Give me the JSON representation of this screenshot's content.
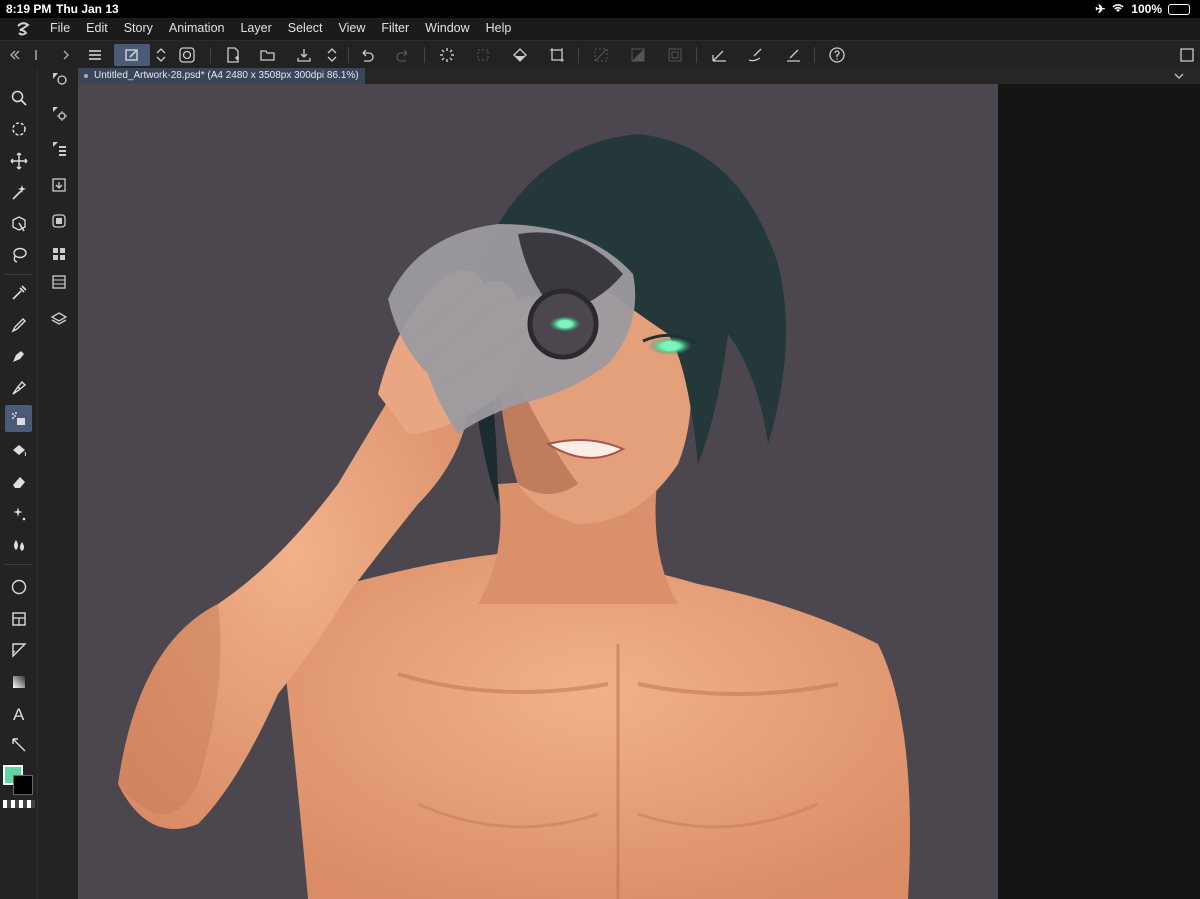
{
  "status_bar": {
    "time": "8:19 PM",
    "date": "Thu Jan 13",
    "battery": "100%",
    "icons": [
      "airplane-icon",
      "wifi-icon",
      "battery-charging-icon"
    ]
  },
  "menu_bar": {
    "items": [
      "File",
      "Edit",
      "Story",
      "Animation",
      "Layer",
      "Select",
      "View",
      "Filter",
      "Window",
      "Help"
    ]
  },
  "document_tab": {
    "title": "Untitled_Artwork-28.psd* (A4 2480 x 3508px 300dpi 86.1%)"
  },
  "tools": [
    "zoom-icon",
    "rotate-icon",
    "move-icon",
    "magic-wand-icon",
    "object-select-icon",
    "lasso-icon",
    "eyedropper-icon",
    "pencil-icon",
    "pen-icon",
    "g-pen-icon",
    "airbrush-icon",
    "fill-icon",
    "eraser-icon",
    "decoration-icon",
    "blend-icon",
    "figure-icon",
    "frame-icon",
    "ruler-icon",
    "gradient-icon",
    "text-icon",
    "correct-line-icon"
  ],
  "colors": {
    "main": "#5fd6a0",
    "sub": "#000000",
    "accent": "#4a5a78"
  }
}
